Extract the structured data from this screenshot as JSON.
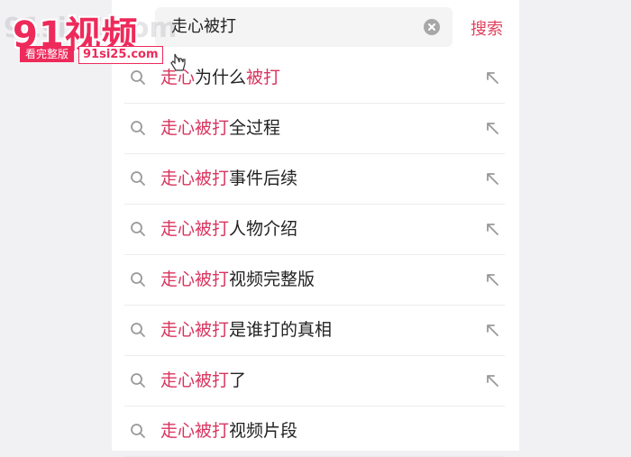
{
  "search": {
    "query": "走心被打",
    "submit_label": "搜索"
  },
  "suggestions": [
    {
      "highlight": "走心",
      "rest": "为什么",
      "tail": "被打",
      "icon": "arrow-up-left-icon"
    },
    {
      "highlight": "走心被打",
      "rest": "全过程",
      "tail": "",
      "icon": "arrow-up-left-icon"
    },
    {
      "highlight": "走心被打",
      "rest": "事件后续",
      "tail": "",
      "icon": "arrow-up-left-icon"
    },
    {
      "highlight": "走心被打",
      "rest": "人物介绍",
      "tail": "",
      "icon": "arrow-up-left-icon"
    },
    {
      "highlight": "走心被打",
      "rest": "视频完整版",
      "tail": "",
      "icon": "arrow-up-left-icon"
    },
    {
      "highlight": "走心被打",
      "rest": "是谁打的真相",
      "tail": "",
      "icon": "arrow-up-left-icon"
    },
    {
      "highlight": "走心被打",
      "rest": "了",
      "tail": "",
      "icon": "arrow-up-left-icon"
    },
    {
      "highlight": "走心被打",
      "rest": "视频片段",
      "tail": "",
      "icon": "arrow-up-left-icon"
    }
  ],
  "watermark": {
    "title": "91视频",
    "tag": "看完整版",
    "url": "91si25.com"
  },
  "colors": {
    "accent": "#d9345e",
    "brand": "#ee2a5b"
  }
}
